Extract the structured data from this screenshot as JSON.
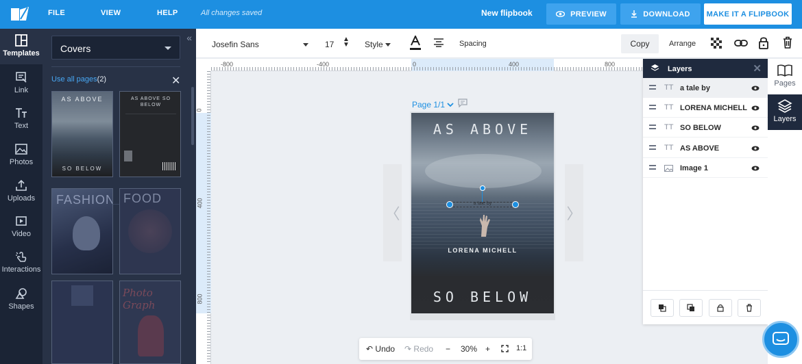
{
  "topbar": {
    "menu": [
      "FILE",
      "VIEW",
      "HELP"
    ],
    "save_status": "All changes saved",
    "doc_title": "New flipbook",
    "preview_label": "PREVIEW",
    "download_label": "DOWNLOAD",
    "make_flipbook_label": "MAKE IT A FLIPBOOK",
    "accent": "#1d8fe1"
  },
  "rail": {
    "items": [
      {
        "label": "Templates",
        "icon": "templates-icon",
        "active": true
      },
      {
        "label": "Link",
        "icon": "link-icon"
      },
      {
        "label": "Text",
        "icon": "text-icon"
      },
      {
        "label": "Photos",
        "icon": "photos-icon"
      },
      {
        "label": "Uploads",
        "icon": "upload-icon"
      },
      {
        "label": "Video",
        "icon": "video-icon"
      },
      {
        "label": "Interactions",
        "icon": "interactions-icon"
      },
      {
        "label": "Shapes",
        "icon": "shapes-icon"
      }
    ]
  },
  "templates_panel": {
    "category": "Covers",
    "use_all_pages": "Use all pages",
    "page_count": "(2)",
    "thumbs": {
      "cover1_title": "AS ABOVE",
      "cover1_sub": "SO BELOW",
      "cover2_title": "AS ABOVE SO BELOW",
      "fashion": "FASHION",
      "food": "FOOD",
      "photo": "Photo Graph"
    }
  },
  "toolbar": {
    "font": "Josefin Sans",
    "font_size": "17",
    "style_label": "Style",
    "spacing_label": "Spacing",
    "copy_label": "Copy",
    "arrange_label": "Arrange"
  },
  "rulers": {
    "top": [
      "-800",
      "-400",
      "0",
      "400",
      "800"
    ],
    "left": [
      "0",
      "400",
      "800"
    ]
  },
  "canvas": {
    "page_label": "Page 1/1",
    "cover": {
      "title": "AS ABOVE",
      "subtitle": "a tale by",
      "author": "LORENA MICHELL",
      "bottom_title": "SO BELOW"
    }
  },
  "zoombar": {
    "undo": "Undo",
    "redo": "Redo",
    "minus": "−",
    "zoom": "30%",
    "plus": "+",
    "ratio": "1:1"
  },
  "layers": {
    "title": "Layers",
    "items": [
      {
        "name": "a tale by",
        "type": "text",
        "active": true
      },
      {
        "name": "LORENA MICHELL",
        "type": "text"
      },
      {
        "name": "SO BELOW",
        "type": "text"
      },
      {
        "name": "AS ABOVE",
        "type": "text"
      },
      {
        "name": "Image 1",
        "type": "image"
      }
    ],
    "type_glyph_text": "TT"
  },
  "right_rail": {
    "pages_label": "Pages",
    "layers_label": "Layers"
  }
}
